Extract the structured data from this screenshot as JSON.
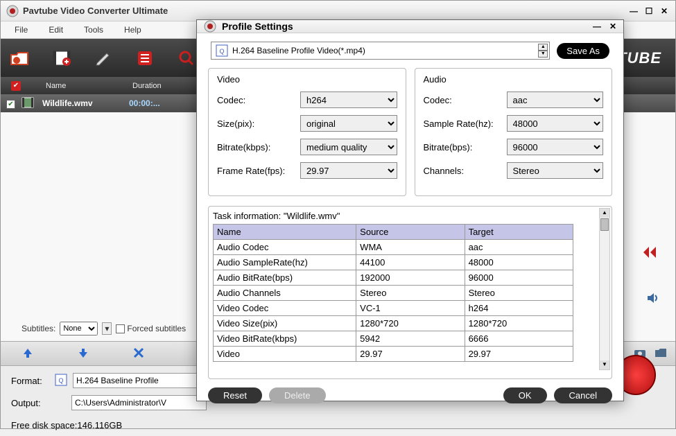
{
  "app": {
    "title": "Pavtube Video Converter Ultimate",
    "brand": "TUBE"
  },
  "menu": {
    "file": "File",
    "edit": "Edit",
    "tools": "Tools",
    "help": "Help"
  },
  "fileList": {
    "headers": {
      "name": "Name",
      "duration": "Duration"
    },
    "row": {
      "name": "Wildlife.wmv",
      "duration": "00:00:..."
    }
  },
  "subtitles": {
    "label": "Subtitles:",
    "value": "None",
    "forced": "Forced subtitles"
  },
  "bottom": {
    "formatLabel": "Format:",
    "formatValue": "H.264 Baseline Profile",
    "outputLabel": "Output:",
    "outputValue": "C:\\Users\\Administrator\\V",
    "diskSpace": "Free disk space:146.116GB"
  },
  "dialog": {
    "title": "Profile Settings",
    "profile": "H.264 Baseline Profile Video(*.mp4)",
    "saveAs": "Save As",
    "videoTitle": "Video",
    "audioTitle": "Audio",
    "video": {
      "codecLabel": "Codec:",
      "codec": "h264",
      "sizeLabel": "Size(pix):",
      "size": "original",
      "bitrateLabel": "Bitrate(kbps):",
      "bitrate": "medium quality",
      "fpsLabel": "Frame Rate(fps):",
      "fps": "29.97"
    },
    "audio": {
      "codecLabel": "Codec:",
      "codec": "aac",
      "srLabel": "Sample Rate(hz):",
      "sr": "48000",
      "bitrateLabel": "Bitrate(bps):",
      "bitrate": "96000",
      "chLabel": "Channels:",
      "ch": "Stereo"
    },
    "taskTitle": "Task information: \"Wildlife.wmv\"",
    "taskHeaders": {
      "name": "Name",
      "source": "Source",
      "target": "Target"
    },
    "taskRows": [
      {
        "n": "Audio Codec",
        "s": "WMA",
        "t": "aac"
      },
      {
        "n": "Audio SampleRate(hz)",
        "s": "44100",
        "t": "48000"
      },
      {
        "n": "Audio BitRate(bps)",
        "s": "192000",
        "t": "96000"
      },
      {
        "n": "Audio Channels",
        "s": "Stereo",
        "t": "Stereo"
      },
      {
        "n": "Video Codec",
        "s": "VC-1",
        "t": "h264"
      },
      {
        "n": "Video Size(pix)",
        "s": "1280*720",
        "t": "1280*720"
      },
      {
        "n": "Video BitRate(kbps)",
        "s": "5942",
        "t": "6666"
      },
      {
        "n": "Video",
        "s": "29.97",
        "t": "29.97"
      }
    ],
    "buttons": {
      "reset": "Reset",
      "delete": "Delete",
      "ok": "OK",
      "cancel": "Cancel"
    }
  }
}
